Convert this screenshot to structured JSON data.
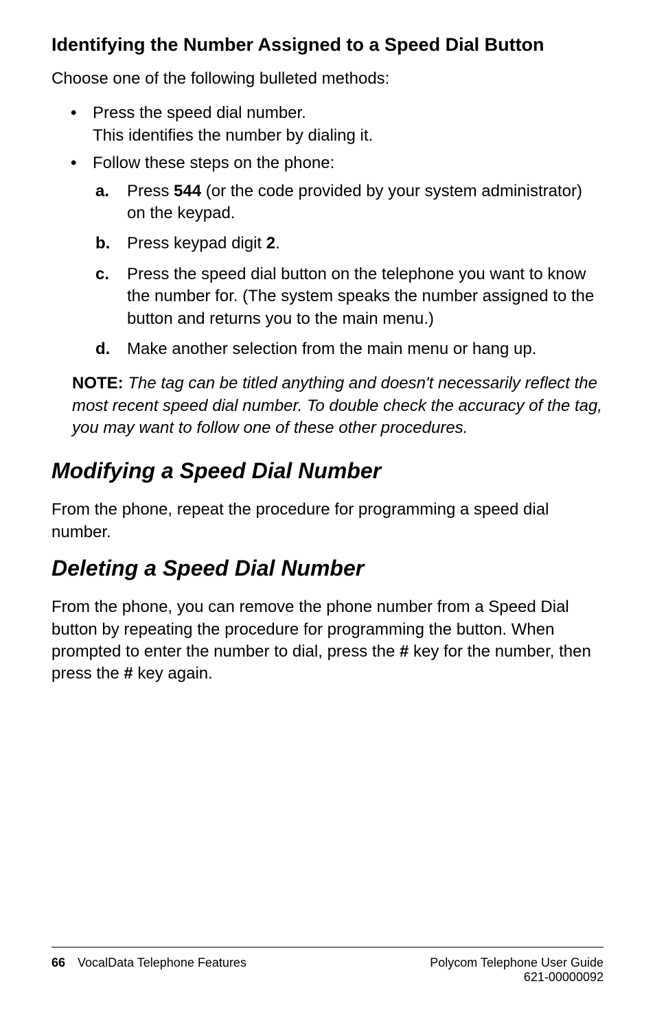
{
  "heading1": "Identifying the Number Assigned to a Speed Dial Button",
  "intro": "Choose one of the following bulleted methods:",
  "bullet1_line1": "Press the speed dial number.",
  "bullet1_line2": "This identifies the number by dialing it.",
  "bullet2_intro": "Follow these steps on the phone:",
  "step_a_letter": "a.",
  "step_a_pre": "Press ",
  "step_a_code": "544",
  "step_a_post": " (or the code provided by your system administrator) on the keypad.",
  "step_b_letter": "b.",
  "step_b_pre": "Press keypad digit ",
  "step_b_digit": "2",
  "step_b_post": ".",
  "step_c_letter": "c.",
  "step_c": "Press the speed dial button on the telephone you want to know the number for. (The system speaks the number assigned to the button and returns you to the main menu.)",
  "step_d_letter": "d.",
  "step_d": "Make another selection from the main menu or hang up.",
  "note_label": "NOTE: ",
  "note_text": "The tag can be titled anything and doesn't necessarily reflect the most recent speed dial number. To double check the accuracy of the tag, you may want to follow one of these other procedures.",
  "heading2": "Modifying a Speed Dial Number",
  "modify_text": "From the phone, repeat the procedure for programming a speed dial number.",
  "heading3": "Deleting a Speed Dial Number",
  "delete_pre": "From the phone, you can remove the phone number from a Speed Dial button by repeating the procedure for programming the button. When prompted to enter the number to dial, press the ",
  "hash1": "#",
  "delete_mid": " key for the number, then press the ",
  "hash2": "#",
  "delete_post": " key again.",
  "footer_page": "66",
  "footer_left": "VocalData Telephone Features",
  "footer_right1": "Polycom Telephone User Guide",
  "footer_right2": "621-00000092"
}
